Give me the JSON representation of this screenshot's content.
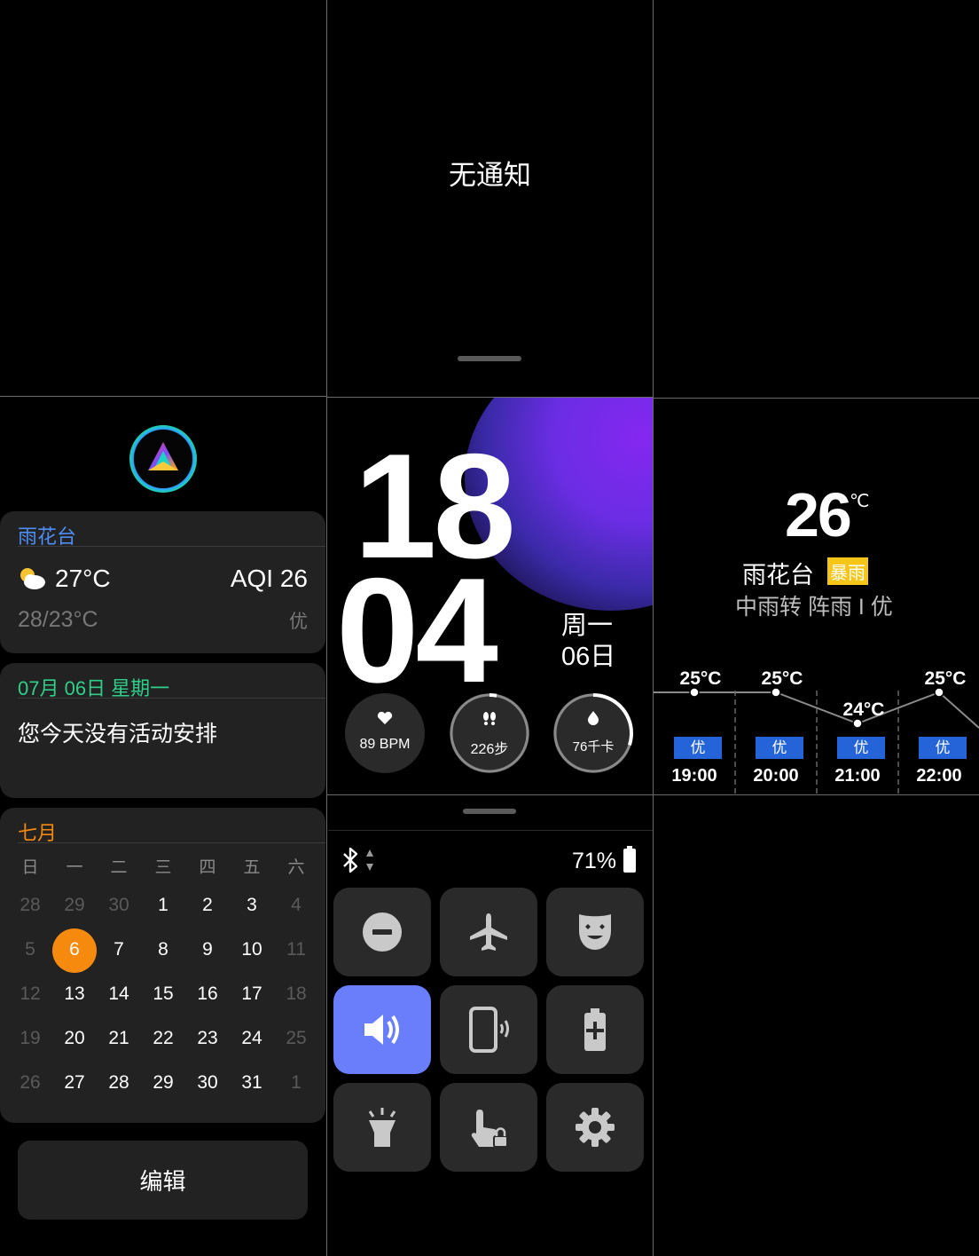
{
  "notifications": {
    "empty_text": "无通知"
  },
  "weather_card": {
    "location": "雨花台",
    "current_temp": "27°C",
    "aqi": "AQI 26",
    "range": "28/23°C",
    "quality": "优"
  },
  "schedule_card": {
    "date": "07月 06日 星期一",
    "message": "您今天没有活动安排"
  },
  "calendar": {
    "month": "七月",
    "weekdays": [
      "日",
      "一",
      "二",
      "三",
      "四",
      "五",
      "六"
    ],
    "weeks": [
      [
        "28",
        "29",
        "30",
        "1",
        "2",
        "3",
        "4"
      ],
      [
        "5",
        "6",
        "7",
        "8",
        "9",
        "10",
        "11"
      ],
      [
        "12",
        "13",
        "14",
        "15",
        "16",
        "17",
        "18"
      ],
      [
        "19",
        "20",
        "21",
        "22",
        "23",
        "24",
        "25"
      ],
      [
        "26",
        "27",
        "28",
        "29",
        "30",
        "31",
        "1"
      ]
    ],
    "today": "6"
  },
  "edit_button": {
    "label": "编辑"
  },
  "watch_face": {
    "hour": "18",
    "minute": "04",
    "weekday": "周一",
    "day": "06日",
    "stats": [
      {
        "icon": "heart-icon",
        "label": "89 BPM",
        "progress": 0
      },
      {
        "icon": "footprints-icon",
        "label": "226步",
        "progress": 0.03
      },
      {
        "icon": "flame-icon",
        "label": "76千卡",
        "progress": 0.3
      }
    ]
  },
  "status_bar": {
    "battery": "71%"
  },
  "quick_settings": [
    {
      "name": "do-not-disturb",
      "icon": "minus-circle-icon",
      "active": false
    },
    {
      "name": "airplane-mode",
      "icon": "airplane-icon",
      "active": false
    },
    {
      "name": "theater-mode",
      "icon": "theater-mask-icon",
      "active": false
    },
    {
      "name": "sound",
      "icon": "speaker-icon",
      "active": true
    },
    {
      "name": "find-phone",
      "icon": "phone-ring-icon",
      "active": false
    },
    {
      "name": "battery-saver",
      "icon": "battery-plus-icon",
      "active": false
    },
    {
      "name": "flashlight",
      "icon": "flashlight-icon",
      "active": false
    },
    {
      "name": "touch-lock",
      "icon": "touch-lock-icon",
      "active": false
    },
    {
      "name": "settings",
      "icon": "gear-icon",
      "active": false
    }
  ],
  "weather_detail": {
    "temp": "26",
    "unit": "℃",
    "location": "雨花台",
    "alert": "暴雨",
    "description": "中雨转 阵雨 I 优",
    "hourly": [
      {
        "time": "19:00",
        "temp": "25°C",
        "aqi": "优"
      },
      {
        "time": "20:00",
        "temp": "25°C",
        "aqi": "优"
      },
      {
        "time": "21:00",
        "temp": "24°C",
        "aqi": "优"
      },
      {
        "time": "22:00",
        "temp": "25°C",
        "aqi": "优"
      }
    ]
  },
  "colors": {
    "accent_orange": "#f58a0e",
    "location_blue": "#4f8df5",
    "date_green": "#2fd08a",
    "active_tile": "#6a7dfb",
    "aqi_chip": "#2563d8",
    "alert_yellow": "#f5c518"
  }
}
